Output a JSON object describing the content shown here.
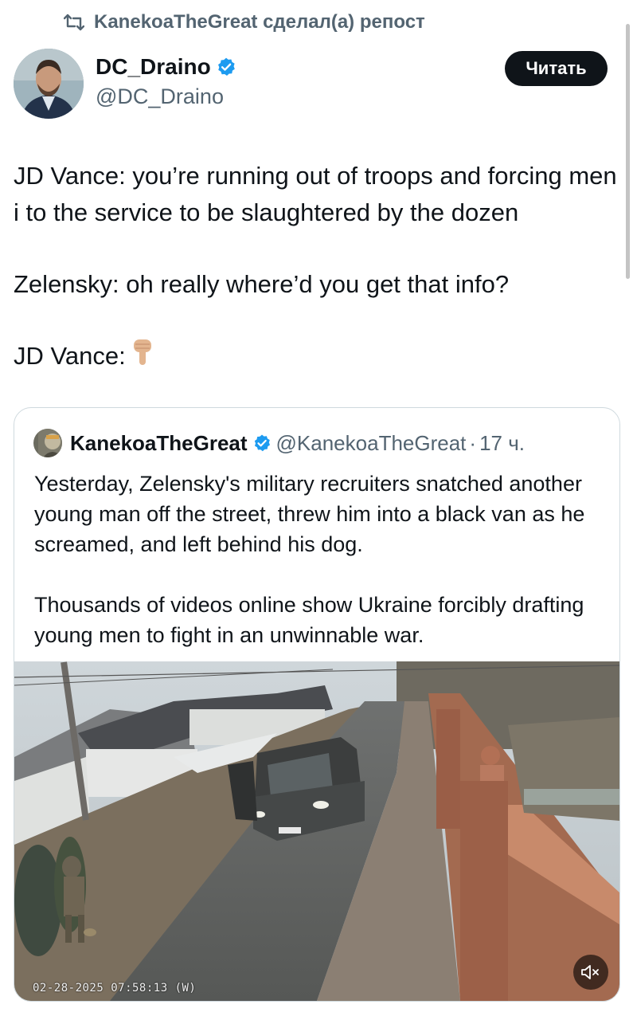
{
  "repost": {
    "text": "KanekoaTheGreat сделал(а) репост",
    "icon": "repost-icon"
  },
  "author": {
    "name": "DC_Draino",
    "handle": "@DC_Draino",
    "verified": true
  },
  "follow_label": "Читать",
  "tweet": {
    "line1": "JD Vance: you’re running out of troops and forcing men i to the service to be slaughtered by the dozen",
    "line2": "Zelensky: oh really where’d you get that info?",
    "line3": "JD Vance:",
    "emoji": "backhand-index-pointing-down-emoji"
  },
  "quote": {
    "name": "KanekoaTheGreat",
    "handle": "@KanekoaTheGreat",
    "separator": "·",
    "time": "17 ч.",
    "verified": true,
    "para1": "Yesterday, Zelensky's military recruiters snatched another young man off the street, threw him into a black van as he screamed, and left behind his dog.",
    "para2": "Thousands of videos online show Ukraine forcibly drafting young men to fight in an unwinnable war.",
    "video": {
      "timestamp": "02-28-2025 07:58:13  (W)",
      "mute_icon": "speaker-muted-icon"
    }
  },
  "colors": {
    "verified": "#1d9bf0",
    "button_bg": "#0f1419",
    "secondary_text": "#536471",
    "border": "#cfd9de"
  }
}
